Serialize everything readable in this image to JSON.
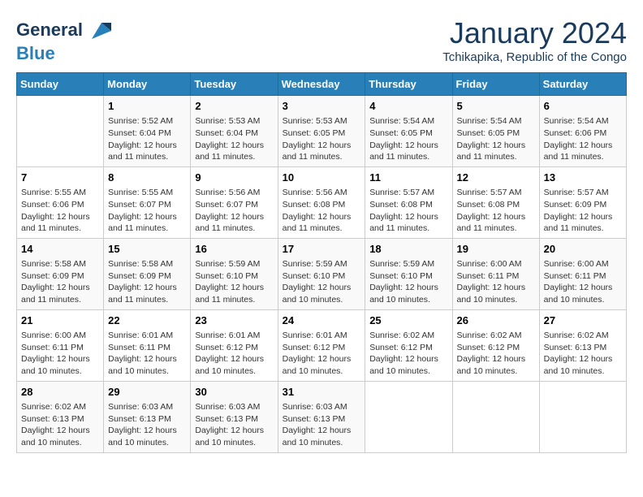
{
  "logo": {
    "line1": "General",
    "line2": "Blue"
  },
  "title": "January 2024",
  "location": "Tchikapika, Republic of the Congo",
  "days_of_week": [
    "Sunday",
    "Monday",
    "Tuesday",
    "Wednesday",
    "Thursday",
    "Friday",
    "Saturday"
  ],
  "weeks": [
    [
      {
        "day": "",
        "info": ""
      },
      {
        "day": "1",
        "info": "Sunrise: 5:52 AM\nSunset: 6:04 PM\nDaylight: 12 hours\nand 11 minutes."
      },
      {
        "day": "2",
        "info": "Sunrise: 5:53 AM\nSunset: 6:04 PM\nDaylight: 12 hours\nand 11 minutes."
      },
      {
        "day": "3",
        "info": "Sunrise: 5:53 AM\nSunset: 6:05 PM\nDaylight: 12 hours\nand 11 minutes."
      },
      {
        "day": "4",
        "info": "Sunrise: 5:54 AM\nSunset: 6:05 PM\nDaylight: 12 hours\nand 11 minutes."
      },
      {
        "day": "5",
        "info": "Sunrise: 5:54 AM\nSunset: 6:05 PM\nDaylight: 12 hours\nand 11 minutes."
      },
      {
        "day": "6",
        "info": "Sunrise: 5:54 AM\nSunset: 6:06 PM\nDaylight: 12 hours\nand 11 minutes."
      }
    ],
    [
      {
        "day": "7",
        "info": "Sunrise: 5:55 AM\nSunset: 6:06 PM\nDaylight: 12 hours\nand 11 minutes."
      },
      {
        "day": "8",
        "info": "Sunrise: 5:55 AM\nSunset: 6:07 PM\nDaylight: 12 hours\nand 11 minutes."
      },
      {
        "day": "9",
        "info": "Sunrise: 5:56 AM\nSunset: 6:07 PM\nDaylight: 12 hours\nand 11 minutes."
      },
      {
        "day": "10",
        "info": "Sunrise: 5:56 AM\nSunset: 6:08 PM\nDaylight: 12 hours\nand 11 minutes."
      },
      {
        "day": "11",
        "info": "Sunrise: 5:57 AM\nSunset: 6:08 PM\nDaylight: 12 hours\nand 11 minutes."
      },
      {
        "day": "12",
        "info": "Sunrise: 5:57 AM\nSunset: 6:08 PM\nDaylight: 12 hours\nand 11 minutes."
      },
      {
        "day": "13",
        "info": "Sunrise: 5:57 AM\nSunset: 6:09 PM\nDaylight: 12 hours\nand 11 minutes."
      }
    ],
    [
      {
        "day": "14",
        "info": "Sunrise: 5:58 AM\nSunset: 6:09 PM\nDaylight: 12 hours\nand 11 minutes."
      },
      {
        "day": "15",
        "info": "Sunrise: 5:58 AM\nSunset: 6:09 PM\nDaylight: 12 hours\nand 11 minutes."
      },
      {
        "day": "16",
        "info": "Sunrise: 5:59 AM\nSunset: 6:10 PM\nDaylight: 12 hours\nand 11 minutes."
      },
      {
        "day": "17",
        "info": "Sunrise: 5:59 AM\nSunset: 6:10 PM\nDaylight: 12 hours\nand 10 minutes."
      },
      {
        "day": "18",
        "info": "Sunrise: 5:59 AM\nSunset: 6:10 PM\nDaylight: 12 hours\nand 10 minutes."
      },
      {
        "day": "19",
        "info": "Sunrise: 6:00 AM\nSunset: 6:11 PM\nDaylight: 12 hours\nand 10 minutes."
      },
      {
        "day": "20",
        "info": "Sunrise: 6:00 AM\nSunset: 6:11 PM\nDaylight: 12 hours\nand 10 minutes."
      }
    ],
    [
      {
        "day": "21",
        "info": "Sunrise: 6:00 AM\nSunset: 6:11 PM\nDaylight: 12 hours\nand 10 minutes."
      },
      {
        "day": "22",
        "info": "Sunrise: 6:01 AM\nSunset: 6:11 PM\nDaylight: 12 hours\nand 10 minutes."
      },
      {
        "day": "23",
        "info": "Sunrise: 6:01 AM\nSunset: 6:12 PM\nDaylight: 12 hours\nand 10 minutes."
      },
      {
        "day": "24",
        "info": "Sunrise: 6:01 AM\nSunset: 6:12 PM\nDaylight: 12 hours\nand 10 minutes."
      },
      {
        "day": "25",
        "info": "Sunrise: 6:02 AM\nSunset: 6:12 PM\nDaylight: 12 hours\nand 10 minutes."
      },
      {
        "day": "26",
        "info": "Sunrise: 6:02 AM\nSunset: 6:12 PM\nDaylight: 12 hours\nand 10 minutes."
      },
      {
        "day": "27",
        "info": "Sunrise: 6:02 AM\nSunset: 6:13 PM\nDaylight: 12 hours\nand 10 minutes."
      }
    ],
    [
      {
        "day": "28",
        "info": "Sunrise: 6:02 AM\nSunset: 6:13 PM\nDaylight: 12 hours\nand 10 minutes."
      },
      {
        "day": "29",
        "info": "Sunrise: 6:03 AM\nSunset: 6:13 PM\nDaylight: 12 hours\nand 10 minutes."
      },
      {
        "day": "30",
        "info": "Sunrise: 6:03 AM\nSunset: 6:13 PM\nDaylight: 12 hours\nand 10 minutes."
      },
      {
        "day": "31",
        "info": "Sunrise: 6:03 AM\nSunset: 6:13 PM\nDaylight: 12 hours\nand 10 minutes."
      },
      {
        "day": "",
        "info": ""
      },
      {
        "day": "",
        "info": ""
      },
      {
        "day": "",
        "info": ""
      }
    ]
  ]
}
